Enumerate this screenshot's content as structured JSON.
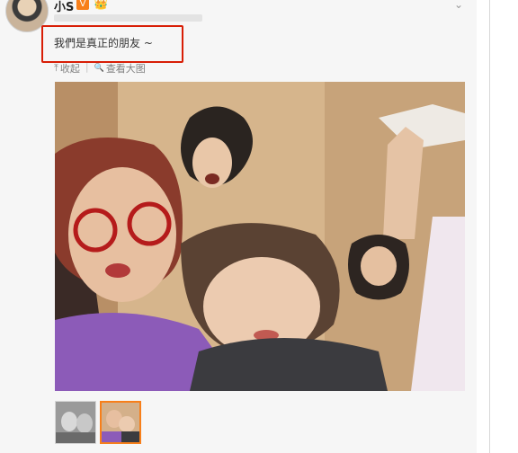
{
  "post": {
    "username": "小S",
    "verified_badge": "V",
    "text": "我們是真正的朋友 ~",
    "toolbar": {
      "collapse_label": "收起",
      "view_large_label": "查看大图"
    }
  },
  "icons": {
    "crown": "👑",
    "collapse": "⤒",
    "search": "🔍",
    "more": "⌄"
  },
  "colors": {
    "highlight_border": "#d81e06",
    "verified_badge": "#f77f1a",
    "thumbnail_active_border": "#f77f1a"
  },
  "thumbnails": [
    {
      "label": "thumbnail-1",
      "active": false
    },
    {
      "label": "thumbnail-2",
      "active": true
    }
  ]
}
